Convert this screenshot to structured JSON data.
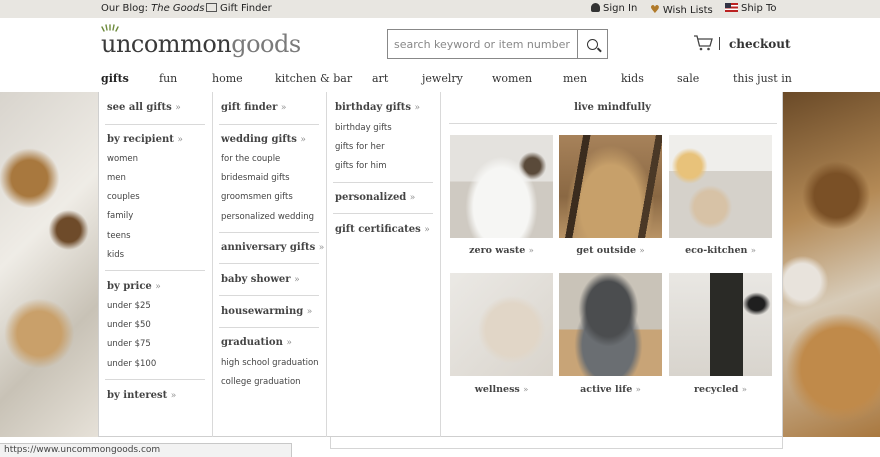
{
  "topbar": {
    "blog_prefix": "Our Blog: ",
    "blog_name": "The Goods",
    "gift_finder": "Gift Finder",
    "sign_in": "Sign In",
    "wish_lists": "Wish Lists",
    "ship_to": "Ship To"
  },
  "header": {
    "logo_part1": "uncommon",
    "logo_part2": "goods",
    "search_placeholder": "search keyword or item number",
    "checkout": "checkout"
  },
  "nav": [
    "gifts",
    "fun",
    "home",
    "kitchen & bar",
    "art",
    "jewelry",
    "women",
    "men",
    "kids",
    "sale",
    "this just in"
  ],
  "menu": {
    "col1": {
      "see_all": "see all gifts",
      "by_recipient": "by recipient",
      "recipients": [
        "women",
        "men",
        "couples",
        "family",
        "teens",
        "kids"
      ],
      "by_price": "by price",
      "prices": [
        "under $25",
        "under $50",
        "under $75",
        "under $100"
      ],
      "by_interest": "by interest"
    },
    "col2": {
      "gift_finder": "gift finder",
      "wedding_gifts": "wedding gifts",
      "wedding_links": [
        "for the couple",
        "bridesmaid gifts",
        "groomsmen gifts",
        "personalized wedding"
      ],
      "anniversary": "anniversary gifts",
      "baby_shower": "baby shower",
      "housewarming": "housewarming",
      "graduation": "graduation",
      "graduation_links": [
        "high school graduation",
        "college graduation"
      ]
    },
    "col3": {
      "birthday": "birthday gifts",
      "birthday_links": [
        "birthday gifts",
        "gifts for her",
        "gifts for him"
      ],
      "personalized": "personalized",
      "gift_certificates": "gift certificates"
    },
    "arrow": "»",
    "live_mindfully": {
      "title": "live mindfully",
      "tiles": [
        "zero waste",
        "get outside",
        "eco-kitchen",
        "wellness",
        "active life",
        "recycled"
      ]
    }
  },
  "status_url": "https://www.uncommongoods.com"
}
